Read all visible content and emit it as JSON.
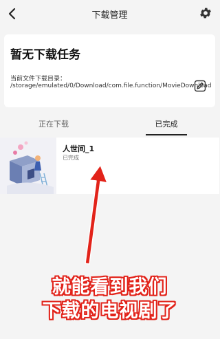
{
  "header": {
    "title": "下载管理"
  },
  "card": {
    "empty_title": "暂无下载任务",
    "dir_label": "当前文件下载目录：",
    "dir_path": "/storage/emulated/0/Download/com.file.function/MovieDownload"
  },
  "tabs": [
    {
      "label": "正在下载",
      "active": false
    },
    {
      "label": "已完成",
      "active": true
    }
  ],
  "items": [
    {
      "title": "人世间_1",
      "status": "已完成"
    }
  ],
  "overlay": {
    "line1": "就能看到我们",
    "line2": "下载的电视剧了",
    "color": "#e2231a"
  }
}
